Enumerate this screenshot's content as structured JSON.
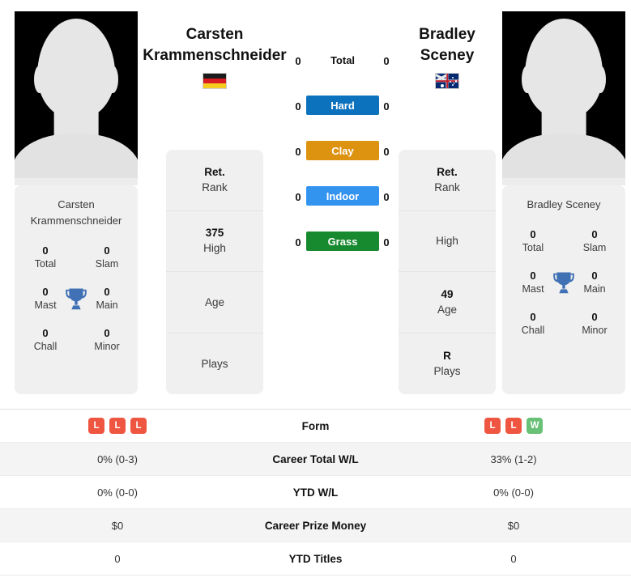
{
  "players": {
    "left": {
      "full_name": "Carsten Krammenschneider",
      "name_line1": "Carsten",
      "name_line2": "Krammenschneider",
      "country_flag": "germany-flag",
      "titles": {
        "total": {
          "value": "0",
          "label": "Total"
        },
        "slam": {
          "value": "0",
          "label": "Slam"
        },
        "mast": {
          "value": "0",
          "label": "Mast"
        },
        "main": {
          "value": "0",
          "label": "Main"
        },
        "chall": {
          "value": "0",
          "label": "Chall"
        },
        "minor": {
          "value": "0",
          "label": "Minor"
        }
      },
      "profile": [
        {
          "value": "Ret.",
          "label": "Rank"
        },
        {
          "value": "375",
          "label": "High"
        },
        {
          "value": "",
          "label": "Age"
        },
        {
          "value": "",
          "label": "Plays"
        }
      ],
      "surface_wins": {
        "total": "0",
        "hard": "0",
        "clay": "0",
        "indoor": "0",
        "grass": "0"
      },
      "form": [
        "L",
        "L",
        "L"
      ],
      "career_total_wl": "0% (0-3)",
      "ytd_wl": "0% (0-0)",
      "career_prize_money": "$0",
      "ytd_titles": "0"
    },
    "right": {
      "full_name": "Bradley Sceney",
      "name_line1": "Bradley",
      "name_line2": "Sceney",
      "country_flag": "australia-flag",
      "titles": {
        "total": {
          "value": "0",
          "label": "Total"
        },
        "slam": {
          "value": "0",
          "label": "Slam"
        },
        "mast": {
          "value": "0",
          "label": "Mast"
        },
        "main": {
          "value": "0",
          "label": "Main"
        },
        "chall": {
          "value": "0",
          "label": "Chall"
        },
        "minor": {
          "value": "0",
          "label": "Minor"
        }
      },
      "profile": [
        {
          "value": "Ret.",
          "label": "Rank"
        },
        {
          "value": "",
          "label": "High"
        },
        {
          "value": "49",
          "label": "Age"
        },
        {
          "value": "R",
          "label": "Plays"
        }
      ],
      "surface_wins": {
        "total": "0",
        "hard": "0",
        "clay": "0",
        "indoor": "0",
        "grass": "0"
      },
      "form": [
        "L",
        "L",
        "W"
      ],
      "career_total_wl": "33% (1-2)",
      "ytd_wl": "0% (0-0)",
      "career_prize_money": "$0",
      "ytd_titles": "0"
    }
  },
  "surfaces": [
    {
      "key": "total",
      "label": "Total",
      "color": ""
    },
    {
      "key": "hard",
      "label": "Hard",
      "color": "#0d72bd"
    },
    {
      "key": "clay",
      "label": "Clay",
      "color": "#dd9210"
    },
    {
      "key": "indoor",
      "label": "Indoor",
      "color": "#3394f0"
    },
    {
      "key": "grass",
      "label": "Grass",
      "color": "#17892f"
    }
  ],
  "stats_table": {
    "rows": [
      {
        "label": "Form",
        "type": "form"
      },
      {
        "label": "Career Total W/L",
        "type": "text"
      },
      {
        "label": "YTD W/L",
        "type": "text"
      },
      {
        "label": "Career Prize Money",
        "type": "text"
      },
      {
        "label": "YTD Titles",
        "type": "text"
      }
    ]
  },
  "colors": {
    "win_badge": "#68c177",
    "loss_badge": "#ef5642",
    "trophy": "#4071b5",
    "card_bg": "#f0f0f0",
    "row_shade": "#f4f4f4"
  },
  "icons": {
    "trophy": "trophy-icon"
  }
}
